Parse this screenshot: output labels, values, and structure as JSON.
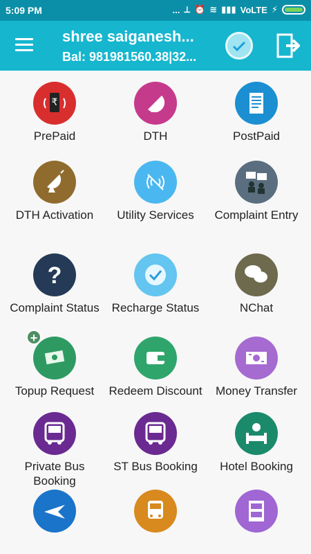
{
  "status_bar": {
    "time": "5:09 PM",
    "network": "VoLTE"
  },
  "header": {
    "title": "shree saiganesh...",
    "balance": "Bal: 981981560.38|32..."
  },
  "tiles": [
    {
      "label": "PrePaid",
      "color": "#d92e2e"
    },
    {
      "label": "DTH",
      "color": "#c63a8c"
    },
    {
      "label": "PostPaid",
      "color": "#1b8fd1"
    },
    {
      "label": "DTH Activation",
      "color": "#8f6b2e"
    },
    {
      "label": "Utility Services",
      "color": "#4bb7f0"
    },
    {
      "label": "Complaint Entry",
      "color": "#5a6e80"
    },
    {
      "label": "Complaint Status",
      "color": "#243a57"
    },
    {
      "label": "Recharge Status",
      "color": "#63c5f0"
    },
    {
      "label": "NChat",
      "color": "#6d6a4d"
    },
    {
      "label": "Topup Request",
      "color": "#2e9a62"
    },
    {
      "label": "Redeem Discount",
      "color": "#2fa56b"
    },
    {
      "label": "Money Transfer",
      "color": "#a56bd0"
    },
    {
      "label": "Private Bus Booking",
      "color": "#6a2a91"
    },
    {
      "label": "ST Bus Booking",
      "color": "#6a2a91"
    },
    {
      "label": "Hotel Booking",
      "color": "#1b8a6b"
    },
    {
      "label": "",
      "color": "#1a74c9"
    },
    {
      "label": "",
      "color": "#d88a1e"
    },
    {
      "label": "",
      "color": "#a066d3"
    }
  ]
}
